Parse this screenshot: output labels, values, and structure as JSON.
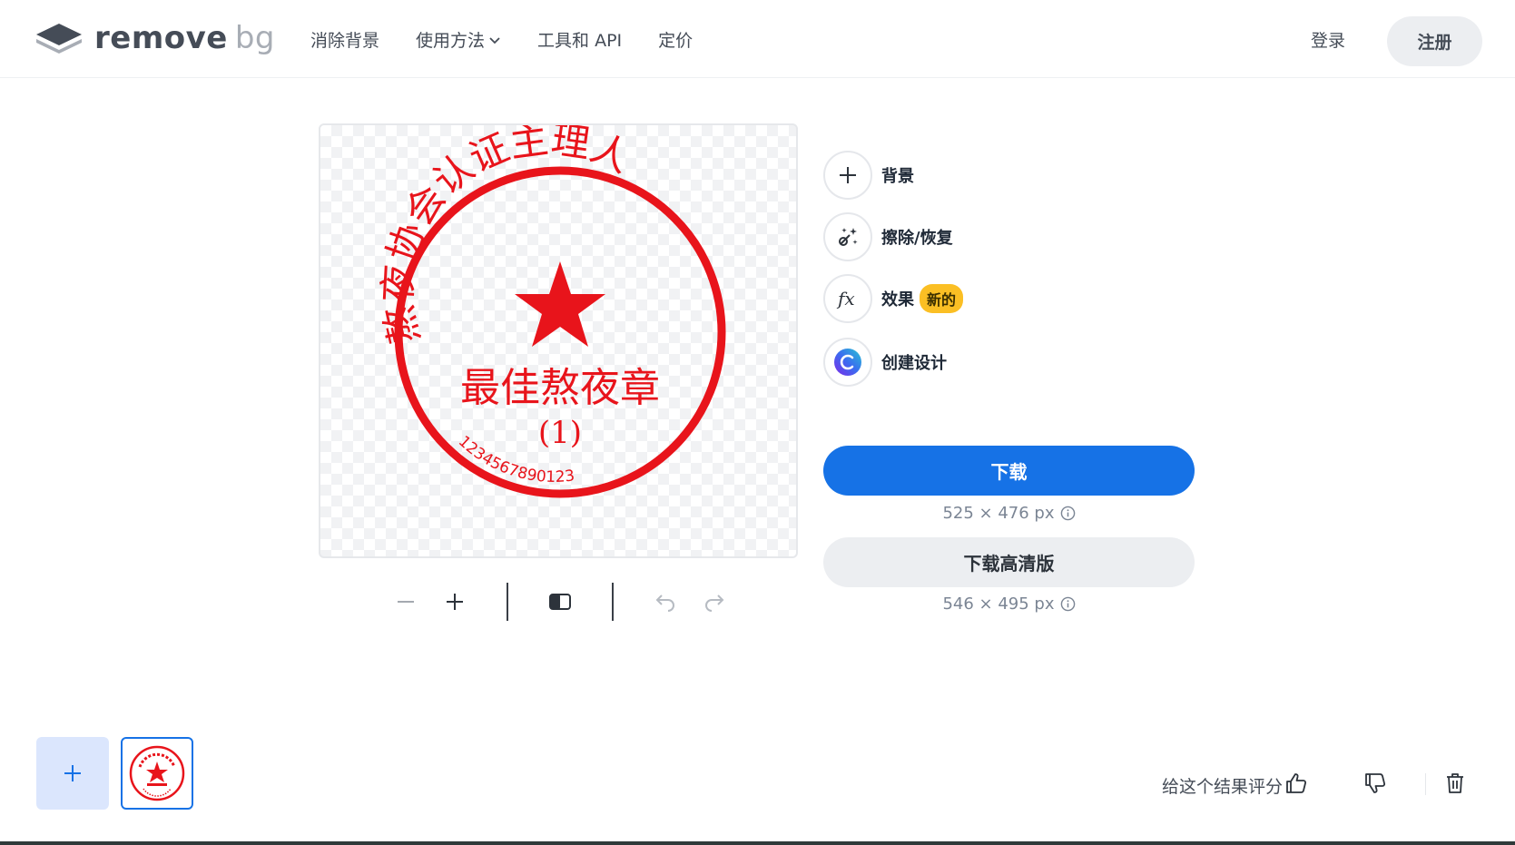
{
  "header": {
    "logo_text": "remove",
    "logo_text_bg": "bg",
    "nav": [
      {
        "label": "消除背景"
      },
      {
        "label": "使用方法"
      },
      {
        "label": "工具和 API"
      },
      {
        "label": "定价"
      }
    ],
    "login_label": "登录",
    "signup_label": "注册"
  },
  "preview": {
    "stamp": {
      "arc_text": "熬夜协会认证主理人",
      "center_text": "最佳熬夜章",
      "sub_text": "(1)",
      "number_text": "1234567890123",
      "color": "#e8141b"
    }
  },
  "tools": [
    {
      "label": "背景",
      "icon": "plus-icon"
    },
    {
      "label": "擦除/恢复",
      "icon": "magic-brush-icon"
    },
    {
      "label": "效果",
      "icon": "fx-icon",
      "badge": "新的"
    },
    {
      "label": "创建设计",
      "icon": "canva-icon"
    }
  ],
  "download": {
    "label": "下载",
    "size": "525 × 476 px",
    "hd_label": "下载高清版",
    "hd_size": "546 × 495 px"
  },
  "feedback": {
    "label": "给这个结果评分"
  },
  "colors": {
    "accent": "#1672e6",
    "badge": "#fbbf24"
  }
}
